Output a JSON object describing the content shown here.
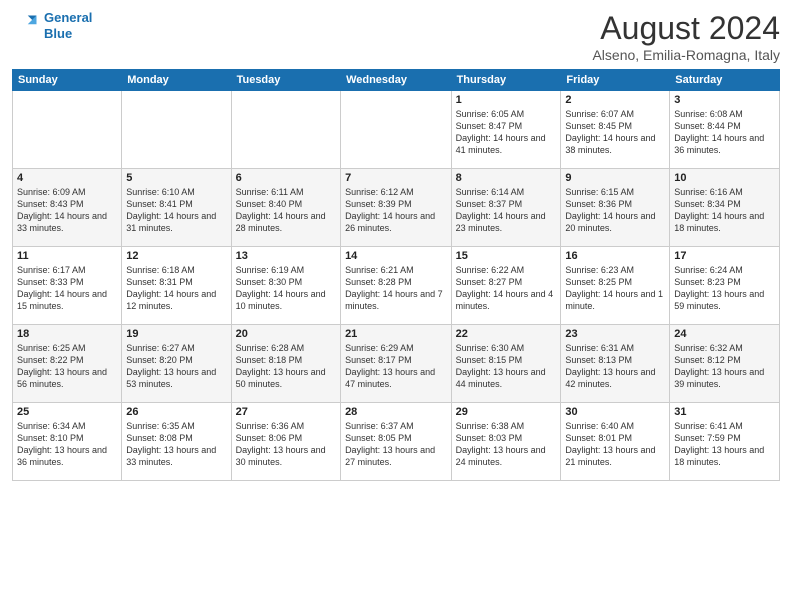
{
  "logo": {
    "line1": "General",
    "line2": "Blue"
  },
  "title": "August 2024",
  "subtitle": "Alseno, Emilia-Romagna, Italy",
  "weekdays": [
    "Sunday",
    "Monday",
    "Tuesday",
    "Wednesday",
    "Thursday",
    "Friday",
    "Saturday"
  ],
  "weeks": [
    [
      {
        "day": "",
        "info": ""
      },
      {
        "day": "",
        "info": ""
      },
      {
        "day": "",
        "info": ""
      },
      {
        "day": "",
        "info": ""
      },
      {
        "day": "1",
        "info": "Sunrise: 6:05 AM\nSunset: 8:47 PM\nDaylight: 14 hours\nand 41 minutes."
      },
      {
        "day": "2",
        "info": "Sunrise: 6:07 AM\nSunset: 8:45 PM\nDaylight: 14 hours\nand 38 minutes."
      },
      {
        "day": "3",
        "info": "Sunrise: 6:08 AM\nSunset: 8:44 PM\nDaylight: 14 hours\nand 36 minutes."
      }
    ],
    [
      {
        "day": "4",
        "info": "Sunrise: 6:09 AM\nSunset: 8:43 PM\nDaylight: 14 hours\nand 33 minutes."
      },
      {
        "day": "5",
        "info": "Sunrise: 6:10 AM\nSunset: 8:41 PM\nDaylight: 14 hours\nand 31 minutes."
      },
      {
        "day": "6",
        "info": "Sunrise: 6:11 AM\nSunset: 8:40 PM\nDaylight: 14 hours\nand 28 minutes."
      },
      {
        "day": "7",
        "info": "Sunrise: 6:12 AM\nSunset: 8:39 PM\nDaylight: 14 hours\nand 26 minutes."
      },
      {
        "day": "8",
        "info": "Sunrise: 6:14 AM\nSunset: 8:37 PM\nDaylight: 14 hours\nand 23 minutes."
      },
      {
        "day": "9",
        "info": "Sunrise: 6:15 AM\nSunset: 8:36 PM\nDaylight: 14 hours\nand 20 minutes."
      },
      {
        "day": "10",
        "info": "Sunrise: 6:16 AM\nSunset: 8:34 PM\nDaylight: 14 hours\nand 18 minutes."
      }
    ],
    [
      {
        "day": "11",
        "info": "Sunrise: 6:17 AM\nSunset: 8:33 PM\nDaylight: 14 hours\nand 15 minutes."
      },
      {
        "day": "12",
        "info": "Sunrise: 6:18 AM\nSunset: 8:31 PM\nDaylight: 14 hours\nand 12 minutes."
      },
      {
        "day": "13",
        "info": "Sunrise: 6:19 AM\nSunset: 8:30 PM\nDaylight: 14 hours\nand 10 minutes."
      },
      {
        "day": "14",
        "info": "Sunrise: 6:21 AM\nSunset: 8:28 PM\nDaylight: 14 hours\nand 7 minutes."
      },
      {
        "day": "15",
        "info": "Sunrise: 6:22 AM\nSunset: 8:27 PM\nDaylight: 14 hours\nand 4 minutes."
      },
      {
        "day": "16",
        "info": "Sunrise: 6:23 AM\nSunset: 8:25 PM\nDaylight: 14 hours\nand 1 minute."
      },
      {
        "day": "17",
        "info": "Sunrise: 6:24 AM\nSunset: 8:23 PM\nDaylight: 13 hours\nand 59 minutes."
      }
    ],
    [
      {
        "day": "18",
        "info": "Sunrise: 6:25 AM\nSunset: 8:22 PM\nDaylight: 13 hours\nand 56 minutes."
      },
      {
        "day": "19",
        "info": "Sunrise: 6:27 AM\nSunset: 8:20 PM\nDaylight: 13 hours\nand 53 minutes."
      },
      {
        "day": "20",
        "info": "Sunrise: 6:28 AM\nSunset: 8:18 PM\nDaylight: 13 hours\nand 50 minutes."
      },
      {
        "day": "21",
        "info": "Sunrise: 6:29 AM\nSunset: 8:17 PM\nDaylight: 13 hours\nand 47 minutes."
      },
      {
        "day": "22",
        "info": "Sunrise: 6:30 AM\nSunset: 8:15 PM\nDaylight: 13 hours\nand 44 minutes."
      },
      {
        "day": "23",
        "info": "Sunrise: 6:31 AM\nSunset: 8:13 PM\nDaylight: 13 hours\nand 42 minutes."
      },
      {
        "day": "24",
        "info": "Sunrise: 6:32 AM\nSunset: 8:12 PM\nDaylight: 13 hours\nand 39 minutes."
      }
    ],
    [
      {
        "day": "25",
        "info": "Sunrise: 6:34 AM\nSunset: 8:10 PM\nDaylight: 13 hours\nand 36 minutes."
      },
      {
        "day": "26",
        "info": "Sunrise: 6:35 AM\nSunset: 8:08 PM\nDaylight: 13 hours\nand 33 minutes."
      },
      {
        "day": "27",
        "info": "Sunrise: 6:36 AM\nSunset: 8:06 PM\nDaylight: 13 hours\nand 30 minutes."
      },
      {
        "day": "28",
        "info": "Sunrise: 6:37 AM\nSunset: 8:05 PM\nDaylight: 13 hours\nand 27 minutes."
      },
      {
        "day": "29",
        "info": "Sunrise: 6:38 AM\nSunset: 8:03 PM\nDaylight: 13 hours\nand 24 minutes."
      },
      {
        "day": "30",
        "info": "Sunrise: 6:40 AM\nSunset: 8:01 PM\nDaylight: 13 hours\nand 21 minutes."
      },
      {
        "day": "31",
        "info": "Sunrise: 6:41 AM\nSunset: 7:59 PM\nDaylight: 13 hours\nand 18 minutes."
      }
    ]
  ]
}
